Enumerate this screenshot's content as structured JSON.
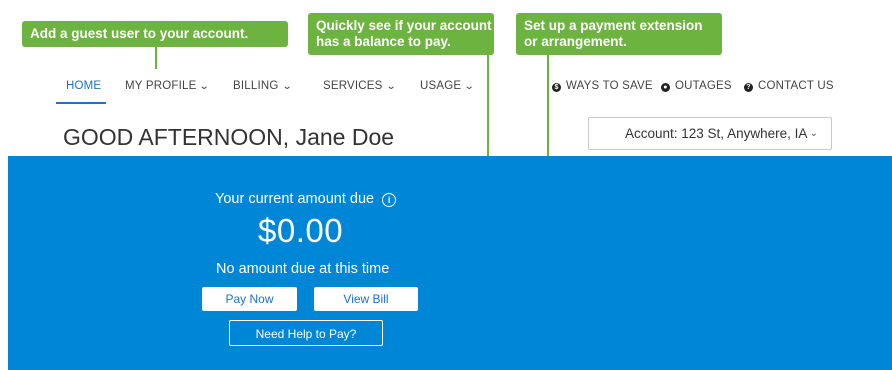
{
  "callouts": {
    "guest": "Add a guest user to your account.",
    "balance": [
      "Quickly see if your account",
      "has a balance to pay."
    ],
    "payment": [
      "Set up a payment extension",
      "or arrangement."
    ]
  },
  "nav": {
    "home": "HOME",
    "my_profile": "MY PROFILE",
    "billing": "BILLING",
    "services": "SERVICES",
    "usage": "USAGE",
    "ways_to_save": "WAYS TO SAVE",
    "outages": "OUTAGES",
    "contact_us": "CONTACT US"
  },
  "greeting": "GOOD AFTERNOON, Jane Doe",
  "account_select": {
    "selected": "Account: 123 St, Anywhere, IA"
  },
  "billing_panel": {
    "due_label": "Your current amount due",
    "amount": "$0.00",
    "status": "No amount due at this time",
    "pay_now": "Pay Now",
    "view_bill": "View Bill",
    "need_help": "Need Help to Pay?"
  },
  "colors": {
    "accent_green": "#6cb33f",
    "panel_blue": "#0086d6",
    "nav_active": "#1a73c8"
  },
  "icons": {
    "dropdown": "chevron-down-icon",
    "info": "info-icon",
    "ways_to_save": "dollar-icon",
    "outages": "power-icon",
    "contact": "question-icon"
  }
}
